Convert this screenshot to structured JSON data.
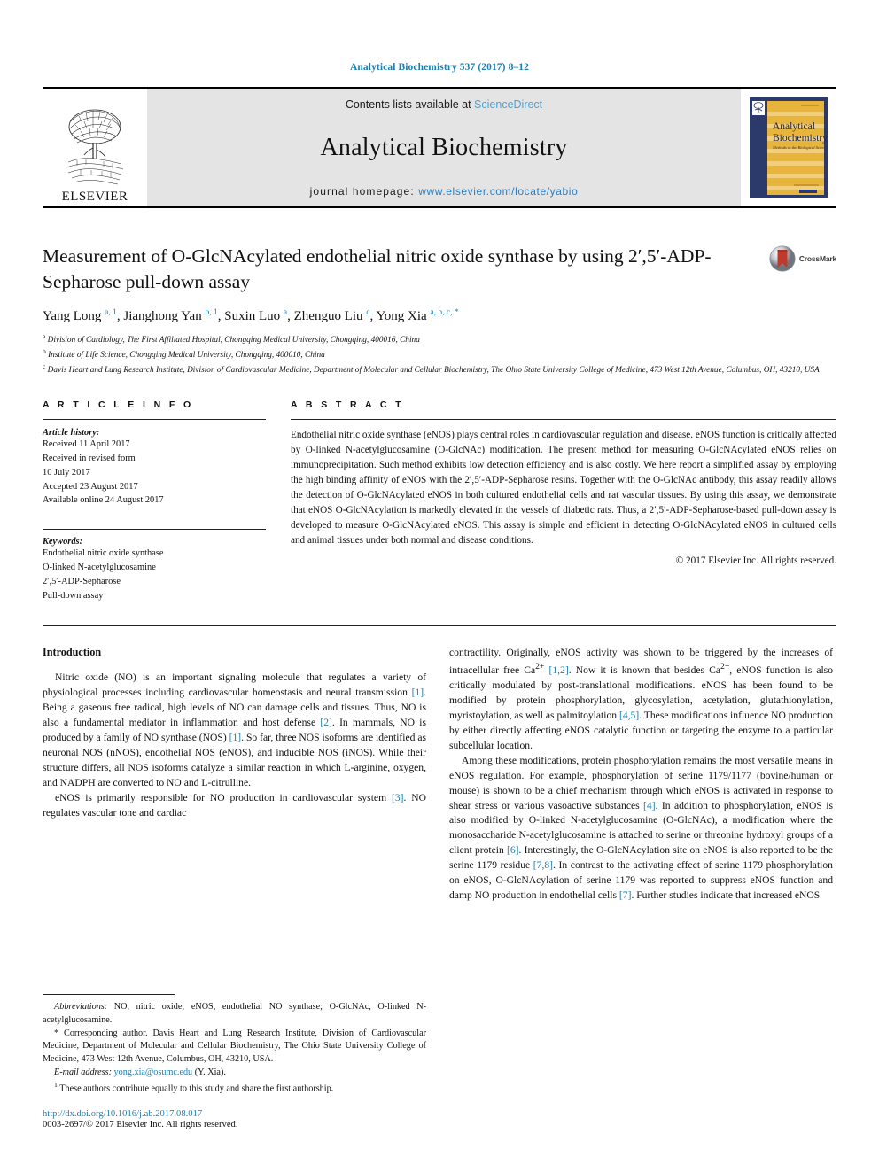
{
  "running_head": "Analytical Biochemistry 537 (2017) 8–12",
  "masthead": {
    "elsevier_wordmark": "ELSEVIER",
    "contents_prefix": "Contents lists available at ",
    "contents_link": "ScienceDirect",
    "journal_title": "Analytical Biochemistry",
    "homepage_prefix": "journal homepage: ",
    "homepage_url": "www.elsevier.com/locate/yabio",
    "cover": {
      "line1": "Analytical",
      "line2": "Biochemistry",
      "tagline": "Methods in the Biological Sciences"
    }
  },
  "article": {
    "title": "Measurement of O-GlcNAcylated endothelial nitric oxide synthase by using 2′,5′-ADP-Sepharose pull-down assay",
    "crossmark_label": "CrossMark",
    "authors_html": "Yang Long <sup>a, 1</sup>, Jianghong Yan <sup>b, 1</sup>, Suxin Luo <sup>a</sup>, Zhenguo Liu <sup>c</sup>, Yong Xia <sup>a, b, c, *</sup>",
    "affiliations": [
      {
        "marker": "a",
        "text": "Division of Cardiology, The First Affiliated Hospital, Chongqing Medical University, Chongqing, 400016, China"
      },
      {
        "marker": "b",
        "text": "Institute of Life Science, Chongqing Medical University, Chongqing, 400010, China"
      },
      {
        "marker": "c",
        "text": "Davis Heart and Lung Research Institute, Division of Cardiovascular Medicine, Department of Molecular and Cellular Biochemistry, The Ohio State University College of Medicine, 473 West 12th Avenue, Columbus, OH, 43210, USA"
      }
    ]
  },
  "article_info": {
    "heading": "A R T I C L E  I N F O",
    "history_label": "Article history:",
    "history": [
      "Received 11 April 2017",
      "Received in revised form",
      "10 July 2017",
      "Accepted 23 August 2017",
      "Available online 24 August 2017"
    ],
    "keywords_label": "Keywords:",
    "keywords": [
      "Endothelial nitric oxide synthase",
      "O-linked N-acetylglucosamine",
      "2′,5′-ADP-Sepharose",
      "Pull-down assay"
    ]
  },
  "abstract": {
    "heading": "A B S T R A C T",
    "body": "Endothelial nitric oxide synthase (eNOS) plays central roles in cardiovascular regulation and disease. eNOS function is critically affected by O-linked N-acetylglucosamine (O-GlcNAc) modification. The present method for measuring O-GlcNAcylated eNOS relies on immunoprecipitation. Such method exhibits low detection efficiency and is also costly. We here report a simplified assay by employing the high binding affinity of eNOS with the 2′,5′-ADP-Sepharose resins. Together with the O-GlcNAc antibody, this assay readily allows the detection of O-GlcNAcylated eNOS in both cultured endothelial cells and rat vascular tissues. By using this assay, we demonstrate that eNOS O-GlcNAcylation is markedly elevated in the vessels of diabetic rats. Thus, a 2′,5′-ADP-Sepharose-based pull-down assay is developed to measure O-GlcNAcylated eNOS. This assay is simple and efficient in detecting O-GlcNAcylated eNOS in cultured cells and animal tissues under both normal and disease conditions.",
    "copyright": "© 2017 Elsevier Inc. All rights reserved."
  },
  "introduction": {
    "heading": "Introduction",
    "left_paragraphs_html": [
      "Nitric oxide (NO) is an important signaling molecule that regulates a variety of physiological processes including cardiovascular homeostasis and neural transmission <span class=\"ref\">[1]</span>. Being a gaseous free radical, high levels of NO can damage cells and tissues. Thus, NO is also a fundamental mediator in inflammation and host defense <span class=\"ref\">[2]</span>. In mammals, NO is produced by a family of NO synthase (NOS) <span class=\"ref\">[1]</span>. So far, three NOS isoforms are identified as neuronal NOS (nNOS), endothelial NOS (eNOS), and inducible NOS (iNOS). While their structure differs, all NOS isoforms catalyze a similar reaction in which L-arginine, oxygen, and NADPH are converted to NO and L-citrulline.",
      "eNOS is primarily responsible for NO production in cardiovascular system <span class=\"ref\">[3]</span>. NO regulates vascular tone and cardiac"
    ],
    "right_paragraphs_html": [
      "contractility. Originally, eNOS activity was shown to be triggered by the increases of intracellular free Ca<sup>2+</sup> <span class=\"ref\">[1,2]</span>. Now it is known that besides Ca<sup>2+</sup>, eNOS function is also critically modulated by post-translational modifications. eNOS has been found to be modified by protein phosphorylation, glycosylation, acetylation, glutathionylation, myristoylation, as well as palmitoylation <span class=\"ref\">[4,5]</span>. These modifications influence NO production by either directly affecting eNOS catalytic function or targeting the enzyme to a particular subcellular location.",
      "Among these modifications, protein phosphorylation remains the most versatile means in eNOS regulation. For example, phosphorylation of serine 1179/1177 (bovine/human or mouse) is shown to be a chief mechanism through which eNOS is activated in response to shear stress or various vasoactive substances <span class=\"ref\">[4]</span>. In addition to phosphorylation, eNOS is also modified by O-linked N-acetylglucosamine (O-GlcNAc), a modification where the monosaccharide N-acetylglucosamine is attached to serine or threonine hydroxyl groups of a client protein <span class=\"ref\">[6]</span>. Interestingly, the O-GlcNAcylation site on eNOS is also reported to be the serine 1179 residue <span class=\"ref\">[7,8]</span>. In contrast to the activating effect of serine 1179 phosphorylation on eNOS, O-GlcNAcylation of serine 1179 was reported to suppress eNOS function and damp NO production in endothelial cells <span class=\"ref\">[7]</span>. Further studies indicate that increased eNOS"
    ]
  },
  "footnotes": {
    "abbreviations_html": "<em>Abbreviations:</em> NO, nitric oxide; eNOS, endothelial NO synthase; O-GlcNAc, O-linked N-acetylglucosamine.",
    "corresponding_html": "* Corresponding author. Davis Heart and Lung Research Institute, Division of Cardiovascular Medicine, Department of Molecular and Cellular Biochemistry, The Ohio State University College of Medicine, 473 West 12th Avenue, Columbus, OH, 43210, USA.",
    "email_label": "E-mail address:",
    "email": "yong.xia@osumc.edu",
    "email_suffix": "(Y. Xia).",
    "equal_contribution_html": "<sup>1</sup> These authors contribute equally to this study and share the first authorship."
  },
  "footer": {
    "doi": "http://dx.doi.org/10.1016/j.ab.2017.08.017",
    "issn": "0003-2697/© 2017 Elsevier Inc. All rights reserved."
  },
  "colors": {
    "link_blue": "#1a7eb0",
    "banner_grey": "#e4e4e4",
    "cover_navy": "#2b3a6b",
    "cover_gold": "#e8b53c",
    "elsevier_orange": "#e87422",
    "crossmark_red": "#c0392b"
  }
}
